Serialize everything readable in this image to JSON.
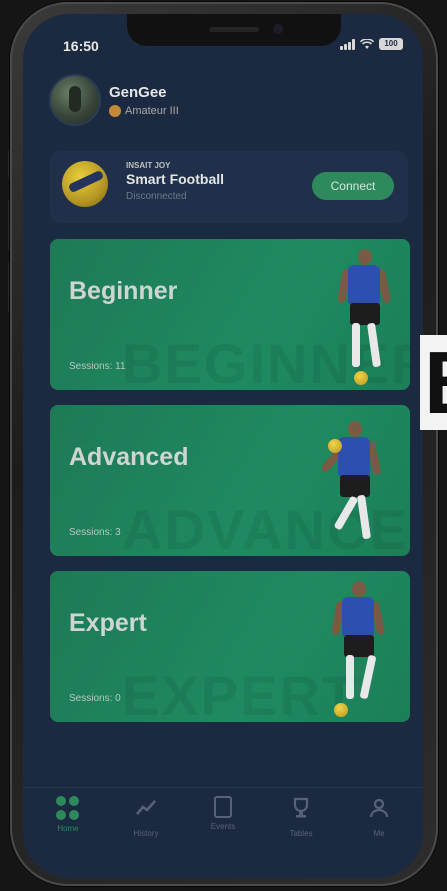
{
  "status_bar": {
    "time": "16:50",
    "battery": "100"
  },
  "profile": {
    "username": "GenGee",
    "rank": "Amateur III"
  },
  "device": {
    "brand": "INSAIT JOY",
    "name": "Smart Football",
    "status": "Disconnected",
    "connect_label": "Connect"
  },
  "levels": [
    {
      "title": "Beginner",
      "sessions": "Sessions: 11",
      "watermark": "BEGINNER"
    },
    {
      "title": "Advanced",
      "sessions": "Sessions: 3",
      "watermark": "ADVANCED"
    },
    {
      "title": "Expert",
      "sessions": "Sessions: 0",
      "watermark": "EXPERT"
    }
  ],
  "tabbar": {
    "items": [
      {
        "label": "Home",
        "icon": "home-grid-icon",
        "active": true
      },
      {
        "label": "History",
        "icon": "chart-line-icon",
        "active": false
      },
      {
        "label": "Events",
        "icon": "document-icon",
        "active": false
      },
      {
        "label": "Tables",
        "icon": "trophy-icon",
        "active": false
      },
      {
        "label": "Me",
        "icon": "person-icon",
        "active": false
      }
    ]
  },
  "side_text": "B",
  "colors": {
    "accent": "#2e8a5c",
    "screen_bg": "#1b2a41",
    "card_bg": "#20304a",
    "level_card": "#1f8a61"
  }
}
